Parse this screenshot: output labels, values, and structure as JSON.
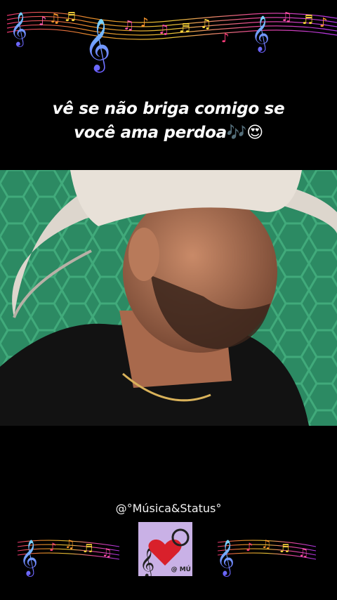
{
  "caption": {
    "line1": "vê se não briga comigo se",
    "line2": "você ama perdoa",
    "emoji": "🎶😍"
  },
  "watermark": {
    "handle": "@°Música&Status°"
  },
  "avatar": {
    "tag": "@ MÚ"
  },
  "colors": {
    "background": "#000000",
    "screen_green": "#2f8e67",
    "hat": "#ddd6cd",
    "avatar_bg": "#c9b1e6",
    "heart": "#d9202b"
  },
  "icons": [
    "treble-clef-icon",
    "music-notes-icon",
    "heart-icon"
  ]
}
